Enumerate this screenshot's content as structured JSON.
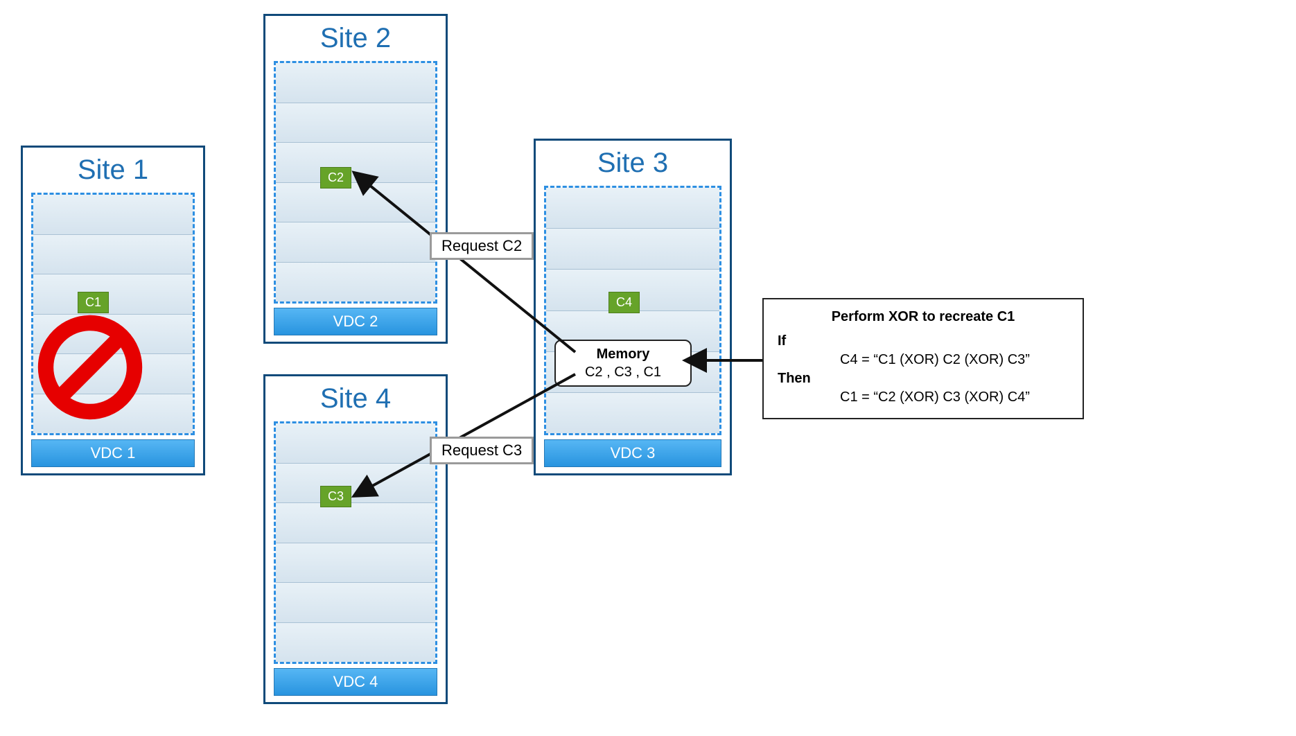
{
  "sites": {
    "s1": {
      "title": "Site 1",
      "vdc": "VDC 1",
      "chip": "C1"
    },
    "s2": {
      "title": "Site 2",
      "vdc": "VDC 2",
      "chip": "C2"
    },
    "s3": {
      "title": "Site 3",
      "vdc": "VDC 3",
      "chip": "C4"
    },
    "s4": {
      "title": "Site 4",
      "vdc": "VDC 4",
      "chip": "C3"
    }
  },
  "memory": {
    "title": "Memory",
    "contents": "C2 , C3 , C1"
  },
  "requests": {
    "c2": "Request C2",
    "c3": "Request C3"
  },
  "xor": {
    "title": "Perform XOR to recreate C1",
    "if_kw": "If",
    "if_body": "C4 = “C1 (XOR) C2 (XOR) C3”",
    "then_kw": "Then",
    "then_body": "C1 = “C2 (XOR) C3 (XOR) C4”"
  }
}
